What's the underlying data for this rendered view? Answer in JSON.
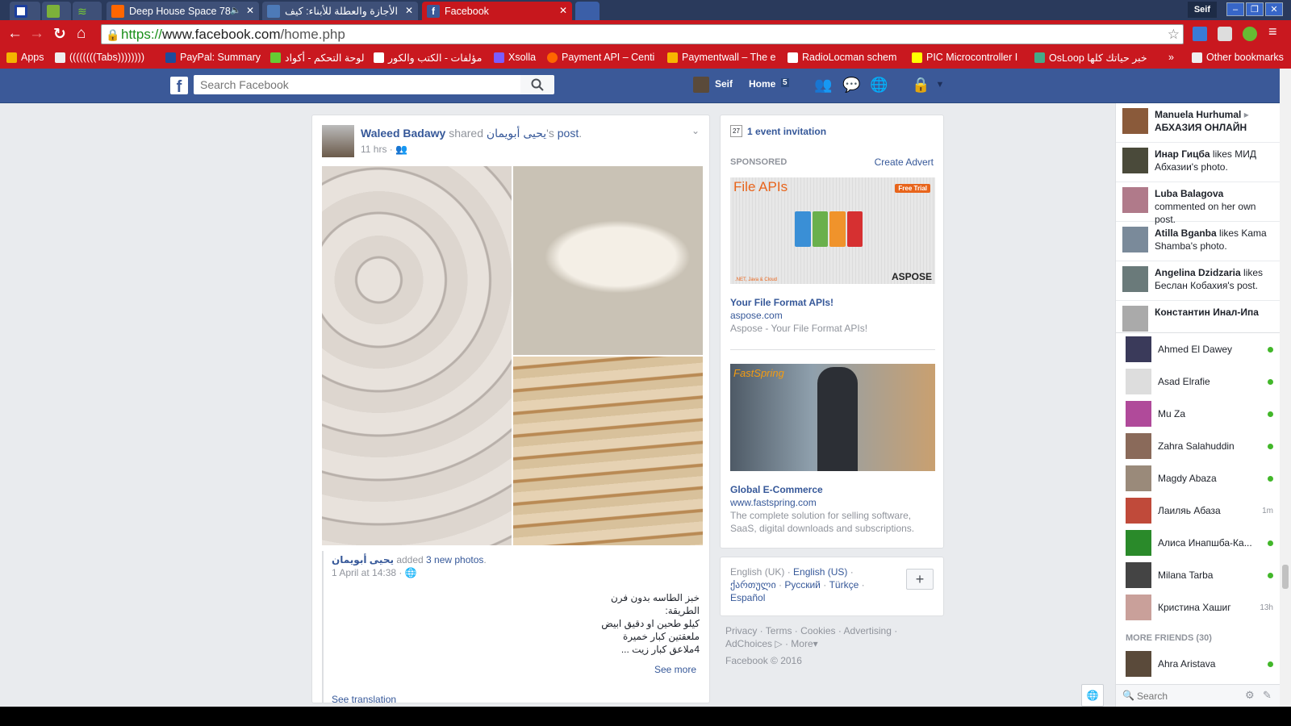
{
  "browser": {
    "tabs": [
      {
        "label": "",
        "favicon": "flag-icon"
      },
      {
        "label": "",
        "favicon": "rt-icon"
      },
      {
        "label": "",
        "favicon": "wifi-icon"
      },
      {
        "label": "Deep House Space 78",
        "favicon": "soundcloud-icon"
      },
      {
        "label": "الأجازة والعطلة للأبناء: كيف",
        "favicon": "site-icon"
      },
      {
        "label": "Facebook",
        "favicon": "facebook-icon"
      }
    ],
    "user": "Seif",
    "url_scheme": "https://",
    "url_host": "www.facebook.com",
    "url_path": "/home.php",
    "bookmarks": [
      "Apps",
      "((((((((Tabs))))))))",
      "PayPal: Summary",
      "لوحة التحكم - أكواد",
      "مؤلفات - الكتب والكور",
      "Xsolla",
      "Payment API – Centi",
      "Paymentwall – The e",
      "RadioLocman schem",
      "PIC Microcontroller I",
      "OsLoop خبر حياتك كلها",
      "»",
      "Other bookmarks"
    ]
  },
  "fb": {
    "search_placeholder": "Search Facebook",
    "profile_name": "Seif",
    "home_label": "Home",
    "home_count": "5"
  },
  "post": {
    "author": "Waleed Badawy",
    "shared_text": "shared",
    "shared_from": "يحيى أبويمان",
    "possessive": "'s",
    "post_word": "post",
    "time": "11 hrs",
    "inner_author": "يحيى أبويمان",
    "inner_added": "added",
    "inner_photos": "3 new photos",
    "inner_time": "1 April at 14:38",
    "body_lines": [
      "خبز الطاسه بدون فرن",
      "الطريقة:",
      "كيلو طحين او دقيق ابيض",
      "ملعقتين كبار خميرة",
      "4ملاعق كبار زيت ..."
    ],
    "see_more": "See more",
    "see_translation": "See translation"
  },
  "sidebar": {
    "event_count": "27",
    "event_invitation": "1 event invitation",
    "sponsored": "SPONSORED",
    "create_advert": "Create Advert",
    "ads": [
      {
        "banner_title": "File APIs",
        "banner_badge": "Free Trial",
        "banner_brand": "ASPOSE",
        "banner_sub": ".NET, Java & Cloud",
        "title": "Your File Format APIs!",
        "domain": "aspose.com",
        "desc": "Aspose - Your File Format APIs!"
      },
      {
        "banner_title": "FastSpring",
        "title": "Global E-Commerce",
        "domain": "www.fastspring.com",
        "desc": "The complete solution for selling software, SaaS, digital downloads and subscriptions."
      }
    ],
    "languages": [
      "English (UK)",
      "English (US)",
      "ქართული",
      "Русский",
      "Türkçe",
      "Español"
    ],
    "footer_links": [
      "Privacy",
      "Terms",
      "Cookies",
      "Advertising",
      "AdChoices",
      "More"
    ],
    "copyright": "Facebook © 2016"
  },
  "ticker": [
    {
      "name": "Manuela Hurhumal",
      "rest": "▸",
      "line2": "АБХАЗИЯ ОНЛАЙН",
      "bold2": true
    },
    {
      "name": "Инар Гицба",
      "rest": "likes МИД Абхазии's photo."
    },
    {
      "name": "Luba Balagova",
      "rest": "commented on her own post."
    },
    {
      "name": "Atilla Bganba",
      "rest": "likes Kama Shamba's photo."
    },
    {
      "name": "Angelina Dzidzaria",
      "rest": "likes Беслан Кобахия's post."
    },
    {
      "name": "Константин Инал-Ипа",
      "rest": ""
    }
  ],
  "chat": [
    {
      "name": "Ahmed El Dawey",
      "status": "online"
    },
    {
      "name": "Asad Elrafie",
      "status": "online"
    },
    {
      "name": "Mu Za",
      "status": "online"
    },
    {
      "name": "Zahra Salahuddin",
      "status": "online"
    },
    {
      "name": "Magdy Abaza",
      "status": "online"
    },
    {
      "name": "Лаиляь Абаза",
      "status": "1m"
    },
    {
      "name": "Алиса Инапшба-Ка...",
      "status": "online"
    },
    {
      "name": "Milana Tarba",
      "status": "online"
    },
    {
      "name": "Кристина Хашиг",
      "status": "13h"
    }
  ],
  "more_friends_label": "MORE FRIENDS (30)",
  "more_friends": [
    {
      "name": "Ahra Aristava",
      "status": "online"
    }
  ],
  "chat_search_placeholder": "Search"
}
